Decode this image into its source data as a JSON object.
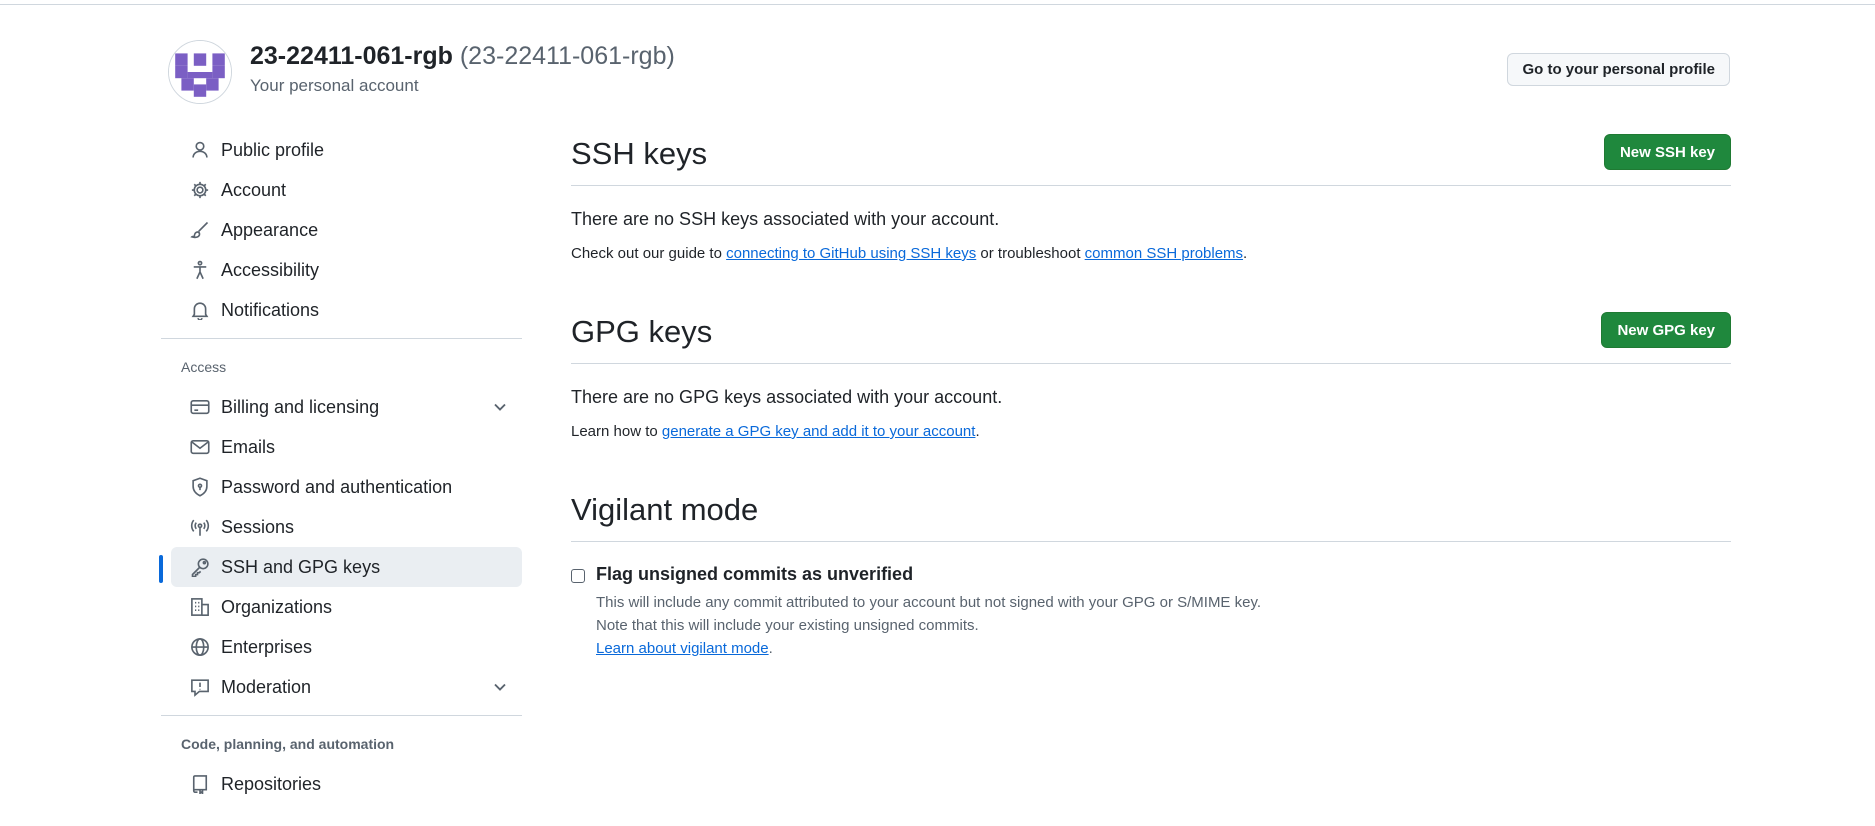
{
  "account": {
    "name": "23-22411-061-rgb",
    "login": "(23-22411-061-rgb)",
    "subtitle": "Your personal account",
    "profile_button": "Go to your personal profile"
  },
  "sidebar": {
    "items": [
      {
        "label": "Public profile",
        "icon": "person-icon"
      },
      {
        "label": "Account",
        "icon": "gear-icon"
      },
      {
        "label": "Appearance",
        "icon": "paintbrush-icon"
      },
      {
        "label": "Accessibility",
        "icon": "accessibility-icon"
      },
      {
        "label": "Notifications",
        "icon": "bell-icon"
      }
    ],
    "access_heading": "Access",
    "access_items": [
      {
        "label": "Billing and licensing",
        "icon": "credit-card-icon",
        "expandable": true
      },
      {
        "label": "Emails",
        "icon": "mail-icon"
      },
      {
        "label": "Password and authentication",
        "icon": "shield-lock-icon"
      },
      {
        "label": "Sessions",
        "icon": "broadcast-icon"
      },
      {
        "label": "SSH and GPG keys",
        "icon": "key-icon",
        "active": true
      },
      {
        "label": "Organizations",
        "icon": "organization-icon"
      },
      {
        "label": "Enterprises",
        "icon": "globe-icon"
      },
      {
        "label": "Moderation",
        "icon": "report-icon",
        "expandable": true
      }
    ],
    "code_heading": "Code, planning, and automation",
    "code_items": [
      {
        "label": "Repositories",
        "icon": "repo-icon"
      }
    ]
  },
  "ssh": {
    "title": "SSH keys",
    "button": "New SSH key",
    "empty": "There are no SSH keys associated with your account.",
    "note_pre": "Check out our guide to ",
    "link1": "connecting to GitHub using SSH keys",
    "note_mid": " or troubleshoot ",
    "link2": "common SSH problems",
    "note_post": "."
  },
  "gpg": {
    "title": "GPG keys",
    "button": "New GPG key",
    "empty": "There are no GPG keys associated with your account.",
    "note_pre": "Learn how to ",
    "link": "generate a GPG key and add it to your account",
    "note_post": "."
  },
  "vigilant": {
    "title": "Vigilant mode",
    "checkbox_label": "Flag unsigned commits as unverified",
    "checked": false,
    "desc1": "This will include any commit attributed to your account but not signed with your GPG or S/MIME key.",
    "desc2": "Note that this will include your existing unsigned commits.",
    "link": "Learn about vigilant mode",
    "link_post": "."
  },
  "colors": {
    "accent": "#0969da",
    "button_green": "#1f883d",
    "avatar": "#7b5fc4"
  }
}
